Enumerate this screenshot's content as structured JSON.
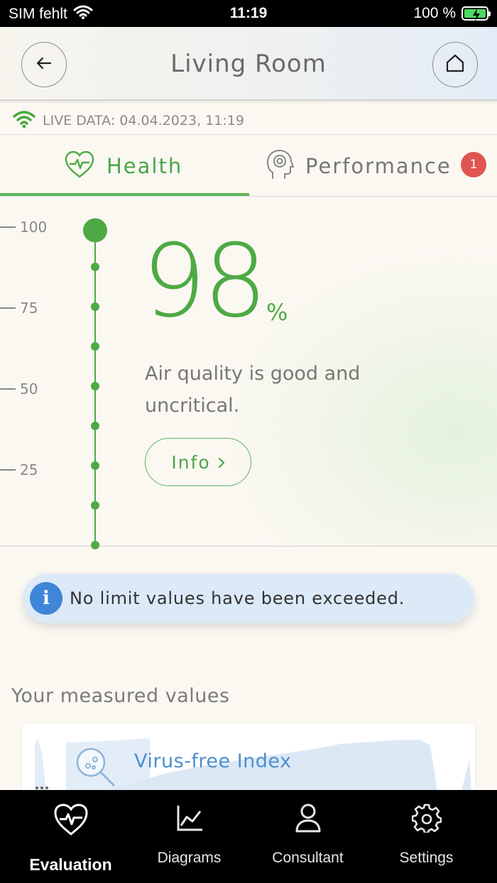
{
  "status_bar": {
    "carrier": "SIM fehlt",
    "time": "11:19",
    "battery": "100 %"
  },
  "header": {
    "title": "Living Room",
    "back_icon": "arrow-left-icon",
    "home_icon": "home-icon"
  },
  "live_data": {
    "label": "LIVE DATA: 04.04.2023, 11:19"
  },
  "tabs": [
    {
      "label": "Health",
      "icon": "heart-pulse-icon",
      "active": true
    },
    {
      "label": "Performance",
      "icon": "head-brain-icon",
      "active": false,
      "badge": "1"
    }
  ],
  "score": {
    "value": "98",
    "unit": "%",
    "description": "Air quality is good and uncritical.",
    "info_label": "Info",
    "scale_ticks": [
      "100",
      "75",
      "50",
      "25"
    ],
    "scale_level": 0.98
  },
  "limit_banner": {
    "icon_text": "i",
    "text": "No limit values have been exceeded."
  },
  "measured": {
    "section_title": "Your measured values",
    "cards": [
      {
        "title": "Virus-free Index",
        "icon": "virus-search-icon"
      }
    ]
  },
  "bottom_nav": [
    {
      "label": "Evaluation",
      "icon": "heart-pulse-icon",
      "active": true
    },
    {
      "label": "Diagrams",
      "icon": "line-chart-icon",
      "active": false
    },
    {
      "label": "Consultant",
      "icon": "person-icon",
      "active": false
    },
    {
      "label": "Settings",
      "icon": "gear-icon",
      "active": false
    }
  ],
  "colors": {
    "accent_green": "#4daa44",
    "info_blue": "#3f86d8",
    "badge_red": "#e05550",
    "link_blue": "#4b8fd0"
  }
}
